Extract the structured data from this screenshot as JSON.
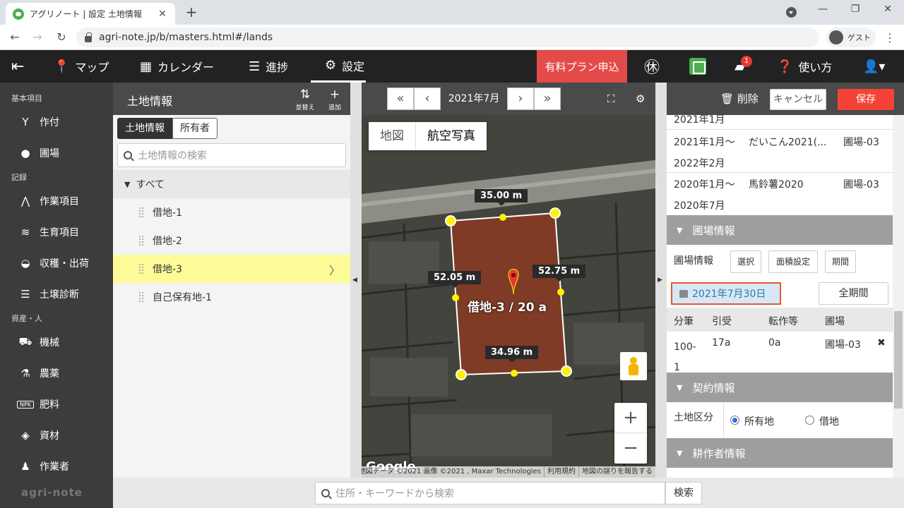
{
  "browser": {
    "tab_title": "アグリノート | 設定 土地情報",
    "url": "agri-note.jp/b/masters.html#/lands",
    "profile_label": "ゲスト"
  },
  "header": {
    "menu": [
      {
        "label": "マップ",
        "icon": "map-pin-icon"
      },
      {
        "label": "カレンダー",
        "icon": "calendar-icon"
      },
      {
        "label": "進捗",
        "icon": "checklist-icon"
      },
      {
        "label": "設定",
        "icon": "gear-icon"
      }
    ],
    "paid_plan_label": "有料プラン申込",
    "notification_count": "1",
    "help_label": "使い方"
  },
  "sidebar": {
    "sections": [
      {
        "title": "基本項目",
        "items": [
          "作付",
          "圃場"
        ]
      },
      {
        "title": "記録",
        "items": [
          "作業項目",
          "生育項目",
          "収穫・出荷",
          "土壌診断"
        ]
      },
      {
        "title": "資産・人",
        "items": [
          "機械",
          "農薬",
          "肥料",
          "資材",
          "作業者"
        ]
      }
    ],
    "logo": "agri-note"
  },
  "land_panel": {
    "title": "土地情報",
    "sort_label": "並替え",
    "add_label": "追加",
    "tabs": [
      "土地情報",
      "所有者"
    ],
    "search_placeholder": "土地情報の検索",
    "root_label": "すべて",
    "lands": [
      "借地-1",
      "借地-2",
      "借地-3",
      "自己保有地-1"
    ],
    "selected_index": 2
  },
  "map": {
    "month": "2021年7月",
    "map_types": [
      "地図",
      "航空写真"
    ],
    "selected_map_type": "航空写真",
    "edge_labels": [
      "35.00 m",
      "52.05 m",
      "52.75 m",
      "34.96 m"
    ],
    "land_label": "借地-3 / 20 a",
    "google_logo": "Google",
    "attributions": [
      "地図データ ©2021 画像 ©2021 , Maxar Technologies",
      "利用規約",
      "地図の誤りを報告する"
    ]
  },
  "detail": {
    "delete_label": "削除",
    "cancel_label": "キャンセル",
    "save_label": "保存",
    "crop_rows": [
      {
        "period": "2021年1月",
        "crop": "",
        "field": ""
      },
      {
        "period": "2021年1月～",
        "crop": "だいこん2021(...",
        "field": "圃場-03"
      },
      {
        "period": "2022年2月",
        "crop": "",
        "field": ""
      },
      {
        "period": "2020年1月～",
        "crop": "馬鈴薯2020",
        "field": "圃場-03"
      },
      {
        "period": "2020年7月",
        "crop": "",
        "field": ""
      }
    ],
    "field_info": {
      "section_title": "圃場情報",
      "label": "圃場情報",
      "buttons": [
        "選択",
        "面積設定",
        "期間"
      ],
      "date": "2021年7月30日",
      "all_period_label": "全期間",
      "columns": [
        "分筆",
        "引受",
        "転作等",
        "圃場"
      ],
      "row": {
        "lot": "100-1",
        "accepted": "17a",
        "conversion": "0a",
        "field": "圃場-03"
      }
    },
    "contract": {
      "section_title": "契約情報",
      "land_type_label": "土地区分",
      "options": [
        "所有地",
        "借地"
      ],
      "selected": "所有地"
    },
    "farmer_section_title": "耕作者情報"
  },
  "bottom_search": {
    "placeholder": "住所・キーワードから検索",
    "button_label": "検索"
  }
}
